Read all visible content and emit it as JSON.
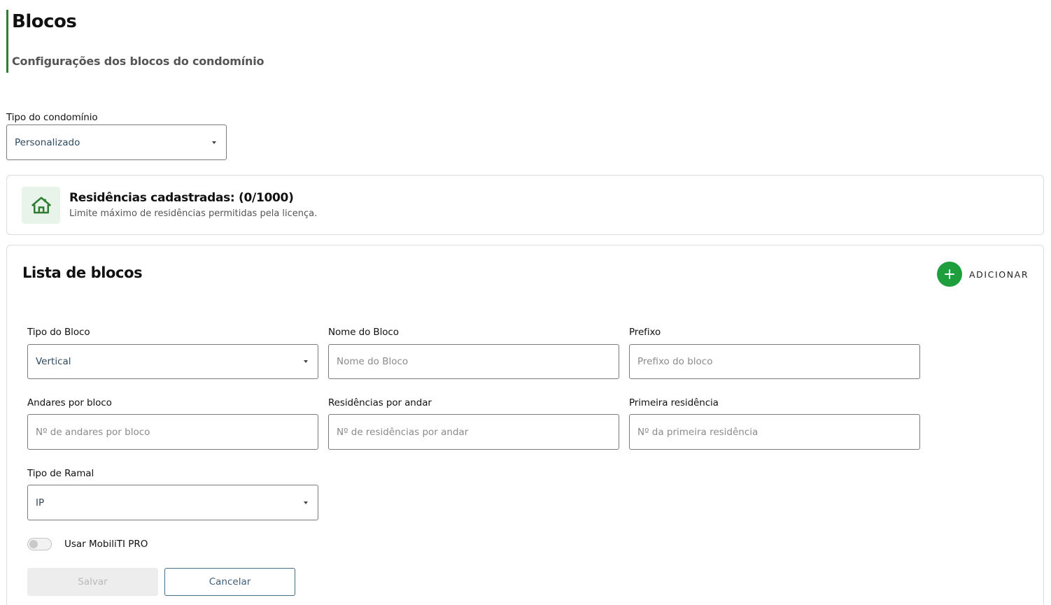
{
  "header": {
    "title": "Blocos",
    "subtitle": "Configurações dos blocos do condomínio"
  },
  "condo_type": {
    "label": "Tipo do condomínio",
    "value": "Personalizado"
  },
  "residences": {
    "title": "Residências cadastradas: (0/1000)",
    "subtitle": "Limite máximo de residências permitidas pela licença.",
    "icon": "house-icon"
  },
  "block_list": {
    "title": "Lista de blocos",
    "add_label": "ADICIONAR"
  },
  "form": {
    "block_type": {
      "label": "Tipo do Bloco",
      "value": "Vertical"
    },
    "block_name": {
      "label": "Nome do Bloco",
      "placeholder": "Nome do Bloco"
    },
    "prefix": {
      "label": "Prefixo",
      "placeholder": "Prefixo do bloco"
    },
    "floors": {
      "label": "Andares por bloco",
      "placeholder": "Nº de andares por bloco"
    },
    "residences_per_floor": {
      "label": "Residências por andar",
      "placeholder": "Nº de residências por andar"
    },
    "first_residence": {
      "label": "Primeira residência",
      "placeholder": "Nº da primeira residência"
    },
    "extension_type": {
      "label": "Tipo de Ramal",
      "value": "IP"
    },
    "mobiliti_toggle": {
      "label": "Usar MobiliTI PRO",
      "checked": false
    },
    "save_label": "Salvar",
    "cancel_label": "Cancelar"
  },
  "colors": {
    "accent_green": "#1e9e3c",
    "header_bar": "#2e7d32",
    "icon_bg": "#e8f3ea"
  }
}
